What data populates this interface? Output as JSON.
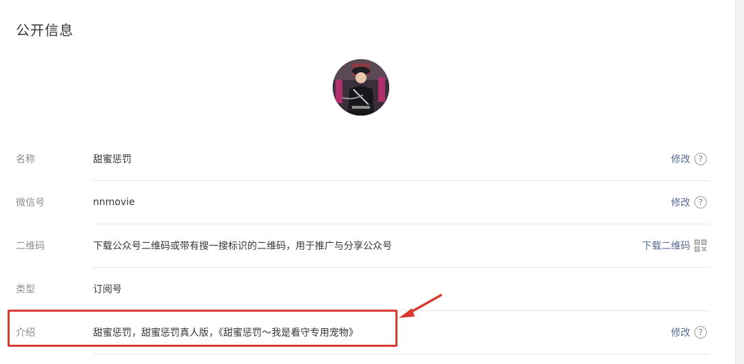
{
  "section": {
    "title": "公开信息"
  },
  "avatar": {
    "alt": "account avatar"
  },
  "rows": [
    {
      "label": "名称",
      "value": "甜蜜惩罚",
      "action": "修改",
      "help": "?"
    },
    {
      "label": "微信号",
      "value": "nnmovie",
      "action": "修改",
      "help": "?"
    },
    {
      "label": "二维码",
      "value": "下载公众号二维码或带有搜一搜标识的二维码，用于推广与分享公众号",
      "action": "下载二维码"
    },
    {
      "label": "类型",
      "value": "订阅号"
    },
    {
      "label": "介绍",
      "value": "甜蜜惩罚，甜蜜惩罚真人版，《甜蜜惩罚～我是看守专用宠物》",
      "action": "修改",
      "help": "?"
    }
  ],
  "colors": {
    "link": "#576b95",
    "label": "#8d8d8d",
    "text": "#353535",
    "divider": "#e7e7eb",
    "annotation": "#d93a30"
  }
}
